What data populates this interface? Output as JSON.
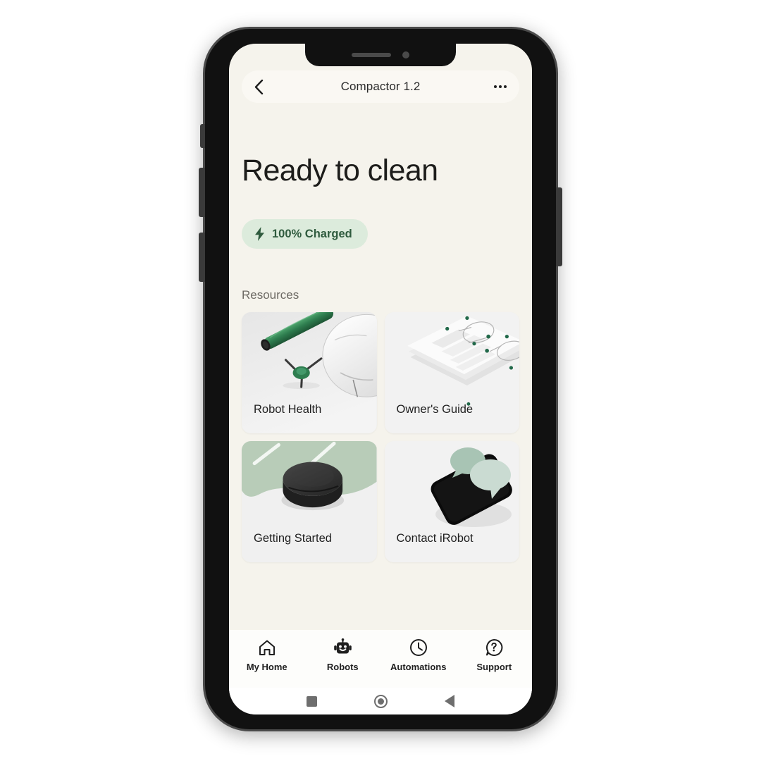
{
  "app": {
    "header": {
      "back_icon": "chevron-left-icon",
      "title": "Compactor 1.2",
      "more_icon": "ellipsis-icon"
    },
    "status": {
      "page_title": "Ready to clean",
      "battery_icon": "lightning-bolt-icon",
      "battery_label": "100% Charged",
      "battery_pill_bg": "#dcebdc",
      "battery_text_color": "#2f5b3e"
    },
    "resources": {
      "section_title": "Resources",
      "cards": [
        {
          "label": "Robot Health",
          "art": "brush-and-robot"
        },
        {
          "label": "Owner's Guide",
          "art": "isometric-pages"
        },
        {
          "label": "Getting Started",
          "art": "robot-on-floor"
        },
        {
          "label": "Contact iRobot",
          "art": "phone-with-chat-bubbles"
        }
      ]
    },
    "tabbar": {
      "tabs": [
        {
          "label": "My Home",
          "icon": "home-icon",
          "active": false
        },
        {
          "label": "Robots",
          "icon": "robot-icon",
          "active": true
        },
        {
          "label": "Automations",
          "icon": "clock-icon",
          "active": false
        },
        {
          "label": "Support",
          "icon": "question-bubble-icon",
          "active": false
        }
      ]
    }
  },
  "device": {
    "navbar": {
      "recents_icon": "square-icon",
      "home_icon": "circle-icon",
      "back_icon": "triangle-left-icon"
    },
    "notch": {
      "speaker": "speaker-slot",
      "camera": "front-camera"
    },
    "buttons": [
      "mute-switch",
      "volume-up",
      "volume-down",
      "power"
    ]
  },
  "theme": {
    "screen_bg": "#f5f3ec",
    "header_bg": "#faf8f3",
    "card_bg": "#eeeeee",
    "tabbar_bg": "#fdfdfb",
    "accent_green": "#2e7d4f",
    "sage": "#b8ccb8"
  }
}
